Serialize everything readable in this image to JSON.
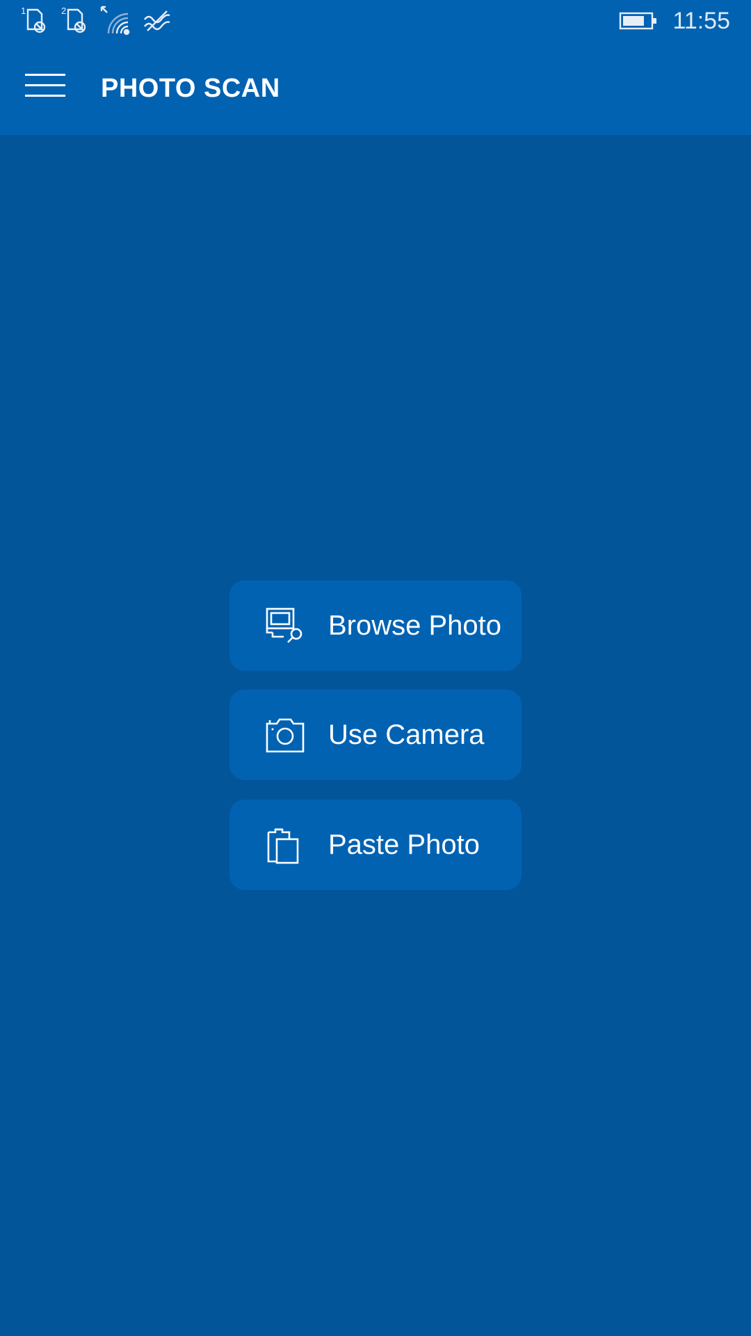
{
  "status_bar": {
    "time": "11:55",
    "sim1_label": "1",
    "sim2_label": "2",
    "icons": [
      "sim1-no-service-icon",
      "sim2-no-service-icon",
      "wifi-icon",
      "data-sense-icon",
      "battery-icon"
    ],
    "battery_level": 0.8
  },
  "app_bar": {
    "title": "PHOTO SCAN",
    "menu_icon": "hamburger-menu-icon"
  },
  "actions": [
    {
      "label": "Browse Photo",
      "icon": "browse-photo-icon"
    },
    {
      "label": "Use Camera",
      "icon": "camera-icon"
    },
    {
      "label": "Paste Photo",
      "icon": "paste-icon"
    }
  ],
  "colors": {
    "app_bar": "#0262b2",
    "background": "#03559a",
    "button": "#0262b2",
    "text": "#ffffff"
  }
}
